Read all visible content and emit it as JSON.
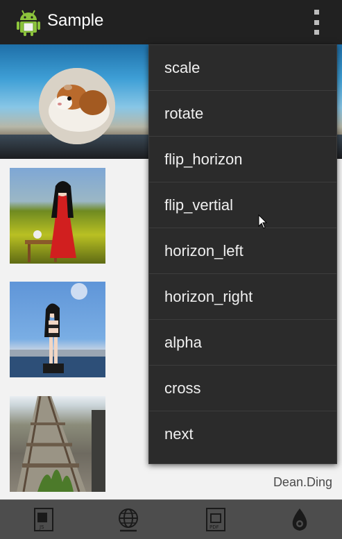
{
  "app": {
    "title": "Sample",
    "icon": "android-robot-icon",
    "overflow_icon": "overflow-menu-icon"
  },
  "signature": "Dean.Ding",
  "thumbnails": [
    "figure-red-dress-photo",
    "figure-swimsuit-photo",
    "railway-tracks-photo"
  ],
  "bottom_bar": {
    "icons": [
      "js-file-icon",
      "globe-icon",
      "pdf-file-icon",
      "flame-logo-icon"
    ]
  },
  "menu": {
    "items": [
      {
        "label": "scale"
      },
      {
        "label": "rotate"
      },
      {
        "label": "flip_horizon"
      },
      {
        "label": "flip_vertial"
      },
      {
        "label": "horizon_left"
      },
      {
        "label": "horizon_right"
      },
      {
        "label": "alpha"
      },
      {
        "label": "cross"
      },
      {
        "label": "next"
      }
    ]
  },
  "colors": {
    "actionbar": "#212121",
    "menu_bg": "#2b2b2b",
    "bottom_bar": "#4d4d4d",
    "android_green": "#8cc43c"
  }
}
